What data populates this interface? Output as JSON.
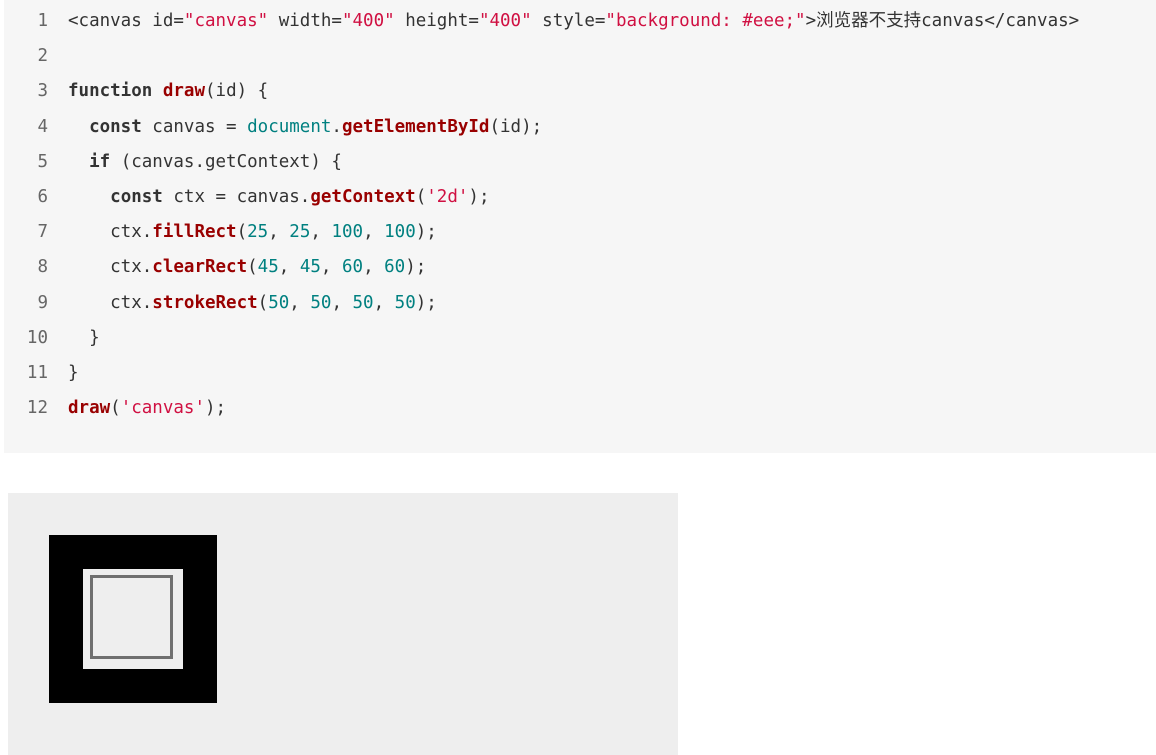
{
  "code": {
    "lines": [
      {
        "n": "1",
        "tokens": [
          {
            "t": "<canvas id=",
            "c": "plain"
          },
          {
            "t": "\"canvas\"",
            "c": "str"
          },
          {
            "t": " width=",
            "c": "plain"
          },
          {
            "t": "\"400\"",
            "c": "str"
          },
          {
            "t": " height=",
            "c": "plain"
          },
          {
            "t": "\"400\"",
            "c": "str"
          },
          {
            "t": " style=",
            "c": "plain"
          },
          {
            "t": "\"background: #eee;\"",
            "c": "str"
          },
          {
            "t": ">",
            "c": "plain"
          },
          {
            "t": "浏览器不支持",
            "c": "cjk"
          },
          {
            "t": "canvas</canvas>",
            "c": "plain"
          }
        ]
      },
      {
        "n": "2",
        "tokens": []
      },
      {
        "n": "3",
        "tokens": [
          {
            "t": "function",
            "c": "kw"
          },
          {
            "t": " ",
            "c": "plain"
          },
          {
            "t": "draw",
            "c": "fn"
          },
          {
            "t": "(id) {",
            "c": "plain"
          }
        ]
      },
      {
        "n": "4",
        "tokens": [
          {
            "t": "  ",
            "c": "plain"
          },
          {
            "t": "const",
            "c": "kw"
          },
          {
            "t": " canvas = ",
            "c": "plain"
          },
          {
            "t": "document",
            "c": "builtin"
          },
          {
            "t": ".",
            "c": "plain"
          },
          {
            "t": "getElementById",
            "c": "fn"
          },
          {
            "t": "(id);",
            "c": "plain"
          }
        ]
      },
      {
        "n": "5",
        "tokens": [
          {
            "t": "  ",
            "c": "plain"
          },
          {
            "t": "if",
            "c": "kw"
          },
          {
            "t": " (canvas.getContext) {",
            "c": "plain"
          }
        ]
      },
      {
        "n": "6",
        "tokens": [
          {
            "t": "    ",
            "c": "plain"
          },
          {
            "t": "const",
            "c": "kw"
          },
          {
            "t": " ctx = canvas.",
            "c": "plain"
          },
          {
            "t": "getContext",
            "c": "fn"
          },
          {
            "t": "(",
            "c": "plain"
          },
          {
            "t": "'2d'",
            "c": "str"
          },
          {
            "t": ");",
            "c": "plain"
          }
        ]
      },
      {
        "n": "7",
        "tokens": [
          {
            "t": "    ctx.",
            "c": "plain"
          },
          {
            "t": "fillRect",
            "c": "fn"
          },
          {
            "t": "(",
            "c": "plain"
          },
          {
            "t": "25",
            "c": "num"
          },
          {
            "t": ", ",
            "c": "plain"
          },
          {
            "t": "25",
            "c": "num"
          },
          {
            "t": ", ",
            "c": "plain"
          },
          {
            "t": "100",
            "c": "num"
          },
          {
            "t": ", ",
            "c": "plain"
          },
          {
            "t": "100",
            "c": "num"
          },
          {
            "t": ");",
            "c": "plain"
          }
        ]
      },
      {
        "n": "8",
        "tokens": [
          {
            "t": "    ctx.",
            "c": "plain"
          },
          {
            "t": "clearRect",
            "c": "fn"
          },
          {
            "t": "(",
            "c": "plain"
          },
          {
            "t": "45",
            "c": "num"
          },
          {
            "t": ", ",
            "c": "plain"
          },
          {
            "t": "45",
            "c": "num"
          },
          {
            "t": ", ",
            "c": "plain"
          },
          {
            "t": "60",
            "c": "num"
          },
          {
            "t": ", ",
            "c": "plain"
          },
          {
            "t": "60",
            "c": "num"
          },
          {
            "t": ");",
            "c": "plain"
          }
        ]
      },
      {
        "n": "9",
        "tokens": [
          {
            "t": "    ctx.",
            "c": "plain"
          },
          {
            "t": "strokeRect",
            "c": "fn"
          },
          {
            "t": "(",
            "c": "plain"
          },
          {
            "t": "50",
            "c": "num"
          },
          {
            "t": ", ",
            "c": "plain"
          },
          {
            "t": "50",
            "c": "num"
          },
          {
            "t": ", ",
            "c": "plain"
          },
          {
            "t": "50",
            "c": "num"
          },
          {
            "t": ", ",
            "c": "plain"
          },
          {
            "t": "50",
            "c": "num"
          },
          {
            "t": ");",
            "c": "plain"
          }
        ]
      },
      {
        "n": "10",
        "tokens": [
          {
            "t": "  }",
            "c": "plain"
          }
        ]
      },
      {
        "n": "11",
        "tokens": [
          {
            "t": "}",
            "c": "plain"
          }
        ]
      },
      {
        "n": "12",
        "tokens": [
          {
            "t": "draw",
            "c": "fn"
          },
          {
            "t": "(",
            "c": "plain"
          },
          {
            "t": "'canvas'",
            "c": "str"
          },
          {
            "t": ");",
            "c": "plain"
          }
        ]
      }
    ]
  },
  "colors": {
    "code_background": "#f6f6f6",
    "string": "#d01042",
    "keyword": "#333333",
    "function": "#990000",
    "number": "#008080",
    "canvas_background": "#eeeeee",
    "fill_rect": "#000000",
    "stroke_rect": "#6f6f6f"
  }
}
